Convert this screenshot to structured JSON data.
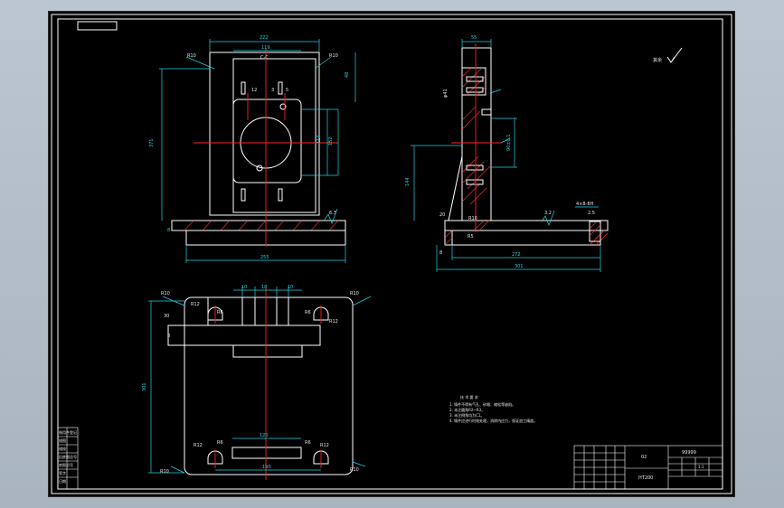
{
  "sheet": {
    "colors": {
      "background": "#000000",
      "part": "#ffffff",
      "dimension": "#22d3e6",
      "centerline": "#ff2020"
    },
    "roughness_symbol_text": "其余"
  },
  "front_view": {
    "dims": {
      "top_width": "222",
      "inner_width": "119",
      "slot_label": "C-C",
      "height": "371",
      "left_height": "8",
      "right_top": "48",
      "hole_v": "114",
      "hole_v2": "152",
      "base_width": "255",
      "r_left": "R10",
      "r_right": "R10",
      "small_a": "12",
      "small_b": "3",
      "small_c": "5",
      "base_rough": "6.3"
    }
  },
  "side_view": {
    "dims": {
      "top_width": "55",
      "left_height": "144",
      "hole_dim": "φ41",
      "hole_dim2": "90±0.1",
      "bottom_width": "272",
      "total_width": "301",
      "r_small": "R10",
      "r_big": "R5",
      "left_small": "8",
      "rough": "3.2",
      "left_tick": "20",
      "side_spec": "4×8-8H",
      "side_spec2": "2.5"
    }
  },
  "top_view": {
    "dims": {
      "left_height": "301",
      "w1": "10",
      "w2": "18",
      "w3": "10",
      "r_tl": "R10",
      "r_tr": "R10",
      "r_bl": "R10",
      "r_br": "R10",
      "r12_a": "R12",
      "r12_b": "R12",
      "r12_c": "R12",
      "r12_d": "R12",
      "r6_a": "R6",
      "r6_b": "R6",
      "r6_c": "R6",
      "r6_d": "R6",
      "inner_w": "120",
      "bottom_w": "190",
      "small_30": "30",
      "small_8": "8"
    }
  },
  "tech_notes": {
    "title": "技 术 要 求",
    "items": [
      "1. 铸件不得有气孔、砂眼、缩松等缺陷。",
      "2. 未注圆角R2~R3。",
      "3. 未注倒角均为C1。",
      "4. 铸件应进行时效处理，消除内应力，保证加工精度。"
    ]
  },
  "title_block": {
    "code": "99999",
    "material": "HT200",
    "scale_field": "1:1",
    "drawing_no": "02"
  },
  "left_strip": {
    "labels": [
      "借用件登记",
      "描图",
      "描校",
      "旧底图总号",
      "底图总号",
      "签字",
      "日期"
    ]
  }
}
